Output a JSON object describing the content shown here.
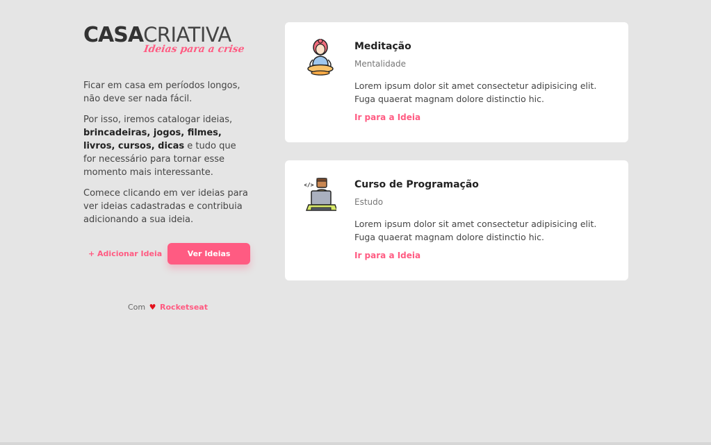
{
  "brand": {
    "logo_bold": "CASA",
    "logo_thin": "CRIATIVA",
    "tagline": "Ideias para a crise"
  },
  "intro": {
    "p1": "Ficar em casa em períodos longos, não deve ser nada fácil.",
    "p2_start": "Por isso, iremos catalogar ideias, ",
    "p2_bold": "brincadeiras, jogos, filmes, livros, cursos, dicas",
    "p2_end": "  e tudo que for necessário para tornar esse momento mais interessante.",
    "p3": "Comece clicando em ver ideias para ver ideias cadastradas e contribuia adicionando a sua ideia."
  },
  "actions": {
    "add_label": "+ Adicionar Ideia",
    "view_label": "Ver Ideias"
  },
  "footer": {
    "prefix": "Com",
    "heart": "♥",
    "brand": "Rocketseat"
  },
  "ideas": [
    {
      "icon": "meditation-icon",
      "title": "Meditação",
      "category": "Mentalidade",
      "description": "Lorem ipsum dolor sit amet consectetur adipisicing elit. Fuga quaerat magnam dolore distinctio hic.",
      "link_label": "Ir para a Ideia"
    },
    {
      "icon": "programmer-icon",
      "title": "Curso de Programação",
      "category": "Estudo",
      "description": "Lorem ipsum dolor sit amet consectetur adipisicing elit. Fuga quaerat magnam dolore distinctio hic.",
      "link_label": "Ir para a Ideia"
    }
  ],
  "colors": {
    "accent": "#ff5b82",
    "background": "#e5e5e5",
    "card": "#ffffff"
  }
}
